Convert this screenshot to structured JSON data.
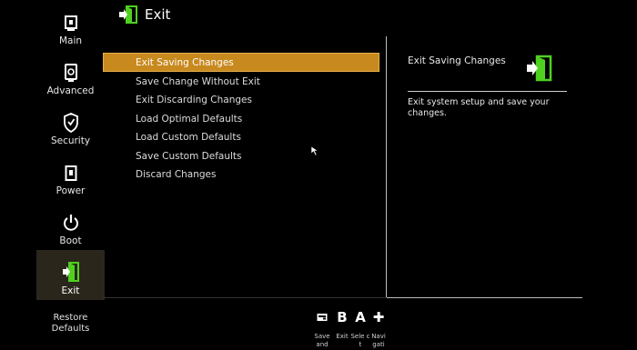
{
  "header": {
    "title": "Exit",
    "icon": "exit-door-icon",
    "accent": "#4fd11f"
  },
  "sidebar": {
    "items": [
      {
        "label": "Main",
        "icon": "main-icon"
      },
      {
        "label": "Advanced",
        "icon": "advanced-icon"
      },
      {
        "label": "Security",
        "icon": "shield-icon"
      },
      {
        "label": "Power",
        "icon": "power-icon"
      },
      {
        "label": "Boot",
        "icon": "boot-power-icon"
      },
      {
        "label": "Exit",
        "icon": "exit-door-icon",
        "active": true
      }
    ],
    "restore_label_1": "Restore",
    "restore_label_2": "Defaults"
  },
  "menu": {
    "items": [
      {
        "label": "Exit Saving Changes",
        "selected": true
      },
      {
        "label": "Save Change Without Exit"
      },
      {
        "label": "Exit Discarding Changes"
      },
      {
        "label": "Load Optimal Defaults"
      },
      {
        "label": "Load Custom Defaults"
      },
      {
        "label": "Save Custom Defaults"
      },
      {
        "label": "Discard Changes"
      }
    ],
    "selected_color": "#c8891e"
  },
  "help": {
    "title": "Exit Saving Changes",
    "description": "Exit system setup and save your changes."
  },
  "hints": [
    {
      "glyph": "⊟",
      "icon": "save-key-icon",
      "label": "Save and"
    },
    {
      "glyph": "B",
      "icon": "b-key-icon",
      "label": "Exit"
    },
    {
      "glyph": "A",
      "icon": "a-key-icon",
      "label": "Sele ct"
    },
    {
      "glyph": "✚",
      "icon": "dpad-icon",
      "label": "Navi gati"
    }
  ]
}
